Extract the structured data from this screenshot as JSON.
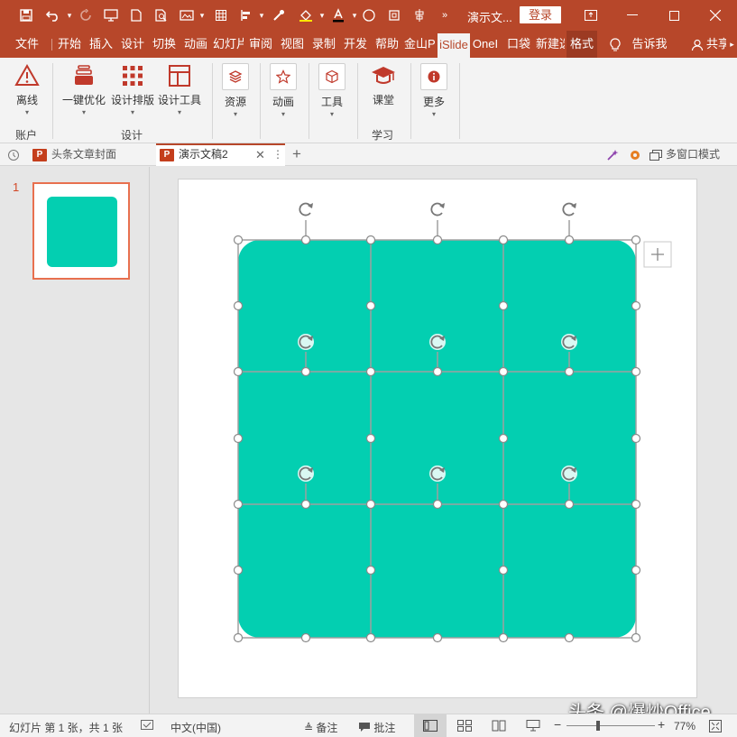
{
  "titlebar": {
    "doc_title": "演示文...",
    "login_label": "登录"
  },
  "tabs": [
    {
      "label": "文件"
    },
    {
      "label": "开始"
    },
    {
      "label": "插入"
    },
    {
      "label": "设计"
    },
    {
      "label": "切换"
    },
    {
      "label": "动画"
    },
    {
      "label": "幻灯片"
    },
    {
      "label": "审阅"
    },
    {
      "label": "视图"
    },
    {
      "label": "录制"
    },
    {
      "label": "开发"
    },
    {
      "label": "帮助"
    },
    {
      "label": "金山P"
    },
    {
      "label": "iSlide"
    },
    {
      "label": "OneI"
    },
    {
      "label": "口袋"
    },
    {
      "label": "新建选"
    },
    {
      "label": "格式"
    },
    {
      "label": "告诉我"
    },
    {
      "label": "共享"
    }
  ],
  "ribbon": {
    "buttons": [
      {
        "label": "离线",
        "icon": "warning-triangle-icon"
      },
      {
        "label": "一键优化",
        "icon": "layers-icon"
      },
      {
        "label": "设计排版",
        "icon": "grid-dots-icon"
      },
      {
        "label": "设计工具",
        "icon": "layout-icon"
      },
      {
        "label": "资源",
        "icon": "stack-icon"
      },
      {
        "label": "动画",
        "icon": "star-icon"
      },
      {
        "label": "工具",
        "icon": "cube-icon"
      },
      {
        "label": "课堂",
        "icon": "graduation-cap-icon"
      },
      {
        "label": "更多",
        "icon": "info-icon"
      }
    ],
    "groups": [
      "账户",
      "设计",
      "学习"
    ]
  },
  "doctabs": {
    "tabs": [
      {
        "label": "头条文章封面"
      },
      {
        "label": "演示文稿2"
      }
    ],
    "multiwindow_label": "多窗口模式"
  },
  "thumbnails": [
    {
      "number": "1"
    }
  ],
  "statusbar": {
    "slide_info": "幻灯片 第 1 张，共 1 张",
    "language": "中文(中国)",
    "notes_label": "备注",
    "comments_label": "批注",
    "zoom": "77%"
  },
  "watermark": "头条 @爆炒Office",
  "colors": {
    "accent": "#b7472a",
    "shape_fill": "#03cfb1"
  }
}
